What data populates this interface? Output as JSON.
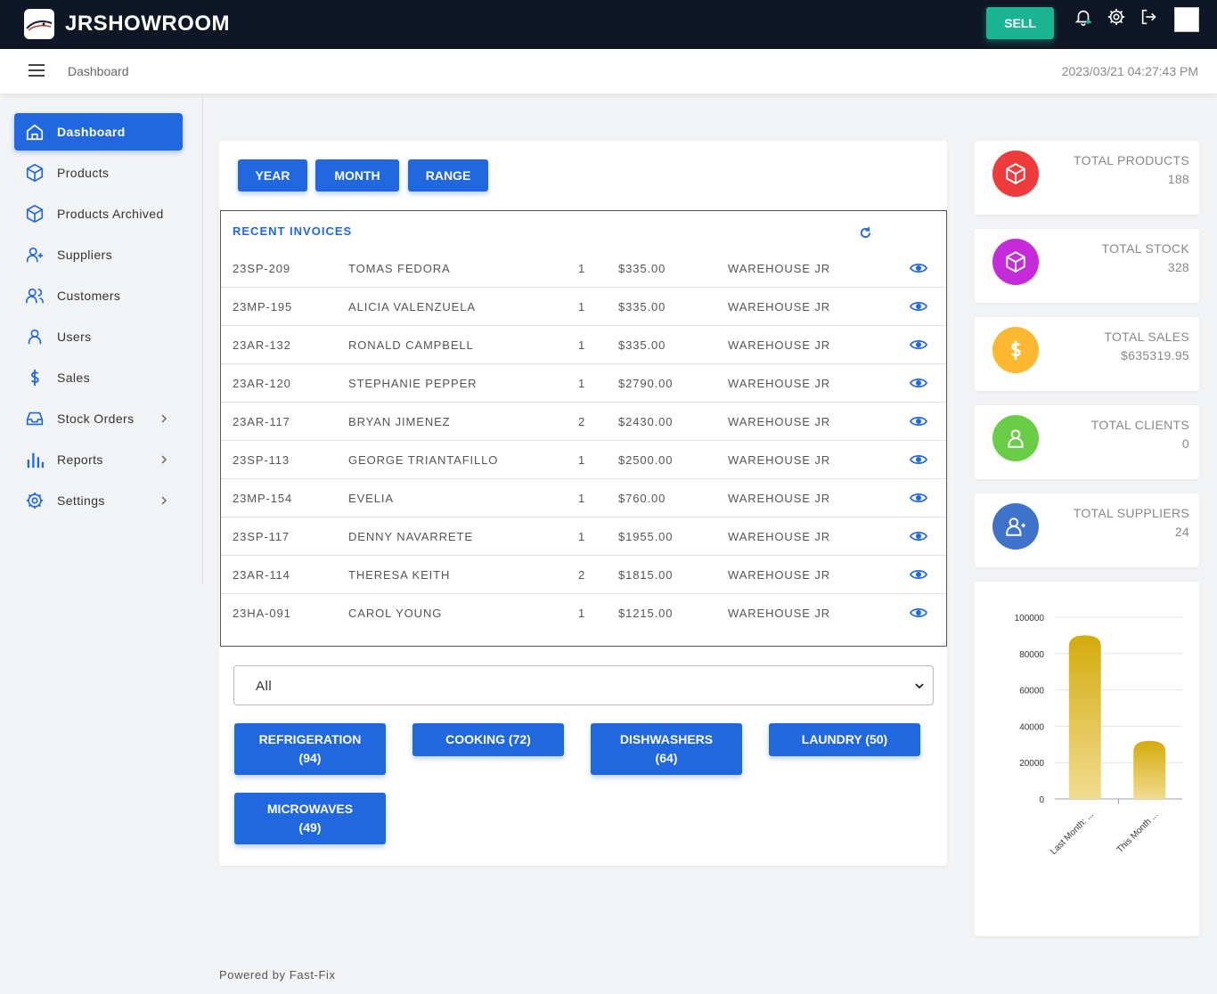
{
  "app": {
    "brand": "JRSHOWROOM",
    "sell_label": "SELL"
  },
  "subheader": {
    "breadcrumb": "Dashboard",
    "datetime": "2023/03/21 04:27:43 PM"
  },
  "sidebar": {
    "items": [
      {
        "label": "Dashboard",
        "icon": "home-icon",
        "active": true
      },
      {
        "label": "Products",
        "icon": "box-icon"
      },
      {
        "label": "Products Archived",
        "icon": "box-icon"
      },
      {
        "label": "Suppliers",
        "icon": "user-plus-icon"
      },
      {
        "label": "Customers",
        "icon": "users-icon"
      },
      {
        "label": "Users",
        "icon": "user-icon"
      },
      {
        "label": "Sales",
        "icon": "dollar-icon"
      },
      {
        "label": "Stock Orders",
        "icon": "inbox-icon",
        "expandable": true
      },
      {
        "label": "Reports",
        "icon": "bar-chart-icon",
        "expandable": true
      },
      {
        "label": "Settings",
        "icon": "gear-icon",
        "expandable": true
      }
    ]
  },
  "filters": {
    "year": "YEAR",
    "month": "MONTH",
    "range": "RANGE"
  },
  "invoices": {
    "title": "RECENT INVOICES",
    "rows": [
      {
        "id": "23SP-209",
        "name": "TOMAS FEDORA",
        "qty": "1",
        "amount": "$335.00",
        "warehouse": "WAREHOUSE JR"
      },
      {
        "id": "23MP-195",
        "name": "ALICIA VALENZUELA",
        "qty": "1",
        "amount": "$335.00",
        "warehouse": "WAREHOUSE JR"
      },
      {
        "id": "23AR-132",
        "name": "RONALD CAMPBELL",
        "qty": "1",
        "amount": "$335.00",
        "warehouse": "WAREHOUSE JR"
      },
      {
        "id": "23AR-120",
        "name": "STEPHANIE PEPPER",
        "qty": "1",
        "amount": "$2790.00",
        "warehouse": "WAREHOUSE JR"
      },
      {
        "id": "23AR-117",
        "name": "BRYAN JIMENEZ",
        "qty": "2",
        "amount": "$2430.00",
        "warehouse": "WAREHOUSE JR"
      },
      {
        "id": "23SP-113",
        "name": "GEORGE TRIANTAFILLO",
        "qty": "1",
        "amount": "$2500.00",
        "warehouse": "WAREHOUSE JR"
      },
      {
        "id": "23MP-154",
        "name": "EVELIA",
        "qty": "1",
        "amount": "$760.00",
        "warehouse": "WAREHOUSE JR"
      },
      {
        "id": "23SP-117",
        "name": "DENNY NAVARRETE",
        "qty": "1",
        "amount": "$1955.00",
        "warehouse": "WAREHOUSE JR"
      },
      {
        "id": "23AR-114",
        "name": "THERESA KEITH",
        "qty": "2",
        "amount": "$1815.00",
        "warehouse": "WAREHOUSE JR"
      },
      {
        "id": "23HA-091",
        "name": "CAROL YOUNG",
        "qty": "1",
        "amount": "$1215.00",
        "warehouse": "WAREHOUSE JR"
      }
    ]
  },
  "category_select": {
    "value": "All"
  },
  "categories": [
    {
      "line1": "REFRIGERATION",
      "line2": "(94)"
    },
    {
      "line1": "COOKING (72)",
      "line2": ""
    },
    {
      "line1": "DISHWASHERS",
      "line2": "(64)"
    },
    {
      "line1": "LAUNDRY (50)",
      "line2": ""
    },
    {
      "line1": "MICROWAVES",
      "line2": "(49)"
    }
  ],
  "stats": [
    {
      "label": "TOTAL PRODUCTS",
      "value": "188",
      "color": "#ef3b3b",
      "icon": "box-icon"
    },
    {
      "label": "TOTAL STOCK",
      "value": "328",
      "color": "#c52bd8",
      "icon": "box-icon"
    },
    {
      "label": "TOTAL SALES",
      "value": "$635319.95",
      "color": "#fcb830",
      "icon": "dollar-icon"
    },
    {
      "label": "TOTAL CLIENTS",
      "value": "0",
      "color": "#69cd47",
      "icon": "user-icon"
    },
    {
      "label": "TOTAL SUPPLIERS",
      "value": "24",
      "color": "#3e73c9",
      "icon": "user-plus-icon"
    }
  ],
  "chart_data": {
    "type": "bar",
    "categories": [
      "Last Month: ...",
      "This Month ..."
    ],
    "values": [
      90000,
      32000
    ],
    "ylim": [
      0,
      100000
    ],
    "yticks": [
      "100000",
      "80000",
      "60000",
      "40000",
      "20000",
      "0"
    ],
    "grid": true,
    "legend": "none",
    "bar_color": "#d4ac0d"
  },
  "footer": {
    "text": "Powered by Fast-Fix"
  }
}
